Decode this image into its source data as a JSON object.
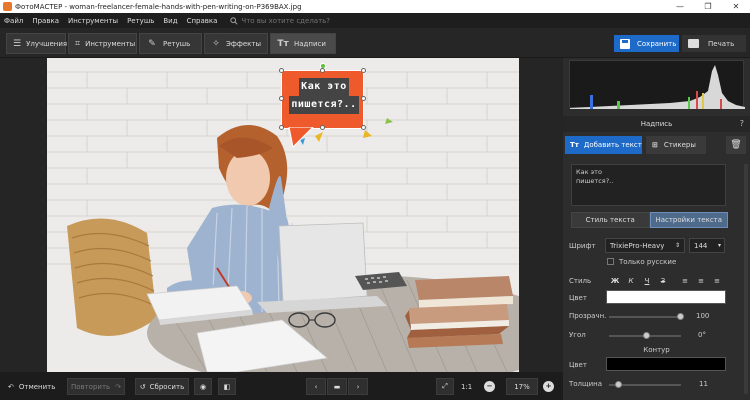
{
  "window": {
    "title": "ФотоМАСТЕР - woman-freelancer-female-hands-with-pen-writing-on-P369BAX.jpg",
    "minimize": "—",
    "maximize": "❐",
    "close": "✕"
  },
  "menu": {
    "items": [
      "Файл",
      "Правка",
      "Инструменты",
      "Ретушь",
      "Вид",
      "Справка"
    ],
    "search_placeholder": "Что вы хотите сделать?"
  },
  "toolbar": {
    "tabs": [
      {
        "label": "Улучшения",
        "icon": "adjust-icon"
      },
      {
        "label": "Инструменты",
        "icon": "crop-icon"
      },
      {
        "label": "Ретушь",
        "icon": "brush-icon"
      },
      {
        "label": "Эффекты",
        "icon": "magic-wand-icon"
      },
      {
        "label": "Надписи",
        "icon": "text-icon"
      }
    ],
    "active_tab": "Надписи",
    "save_label": "Сохранить",
    "print_label": "Печать"
  },
  "canvas": {
    "bubble_text_line1": "Как это",
    "bubble_text_line2": "пишется?..",
    "bubble_color": "#ef5a2c"
  },
  "bottom": {
    "undo_label": "Отменить",
    "redo_label": "Повторить",
    "reset_label": "Сбросить",
    "zoom_one": "1:1",
    "zoom_value": "17%"
  },
  "panel": {
    "section_title": "Надпись",
    "help": "?",
    "add_text_label": "Добавить текст",
    "stickers_label": "Стикеры",
    "text_value": "Как это\nпишется?..",
    "subtab_style": "Стиль текста",
    "subtab_settings": "Настройки текста",
    "font_label": "Шрифт",
    "font_value": "TrixiePro-Heavy",
    "font_size": "144",
    "only_russian_label": "Только русские",
    "style_label": "Стиль",
    "color_label": "Цвет",
    "color_value": "#ffffff",
    "opacity_label": "Прозрачн.",
    "opacity_value": "100",
    "angle_label": "Угол",
    "angle_value": "0°",
    "outline_title": "Контур",
    "outline_color_label": "Цвет",
    "outline_color_value": "#000000",
    "thickness_label": "Толщина",
    "thickness_value": "11"
  },
  "colors": {
    "accent": "#1e6ac8",
    "panel_bg": "#2d2d2d"
  }
}
